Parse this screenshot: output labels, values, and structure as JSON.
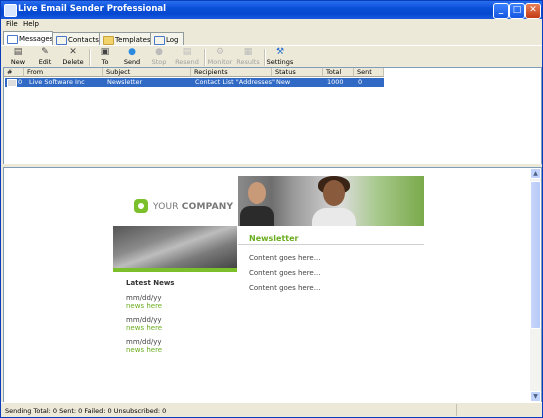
{
  "window": {
    "title": "Live Email Sender Professional"
  },
  "menu": [
    "File",
    "Help"
  ],
  "tabs": [
    "Messages",
    "Contacts",
    "Templates",
    "Log"
  ],
  "toolbar": [
    {
      "label": "New",
      "icon": "new-icon",
      "enabled": true
    },
    {
      "label": "Edit",
      "icon": "edit-icon",
      "enabled": true
    },
    {
      "label": "Delete",
      "icon": "delete-icon",
      "enabled": true
    },
    {
      "label": "To",
      "icon": "to-icon",
      "enabled": true
    },
    {
      "label": "Send",
      "icon": "send-icon",
      "enabled": true
    },
    {
      "label": "Stop",
      "icon": "stop-icon",
      "enabled": false
    },
    {
      "label": "Resend",
      "icon": "resend-icon",
      "enabled": false
    },
    {
      "label": "Monitor",
      "icon": "monitor-icon",
      "enabled": false
    },
    {
      "label": "Results",
      "icon": "results-icon",
      "enabled": false
    },
    {
      "label": "Settings",
      "icon": "settings-icon",
      "enabled": true
    }
  ],
  "table": {
    "columns": [
      "#",
      "From",
      "Subject",
      "Recipients",
      "Status",
      "Total",
      "Sent"
    ],
    "rows": [
      {
        "num": "0",
        "from": "Live Software Inc",
        "subject": "Newsletter",
        "recipients": "Contact List \"Addresses\"",
        "status": "New",
        "total": "1000",
        "sent": "0"
      }
    ]
  },
  "preview": {
    "logo_your": "YOUR ",
    "logo_company": "COMPANY",
    "newsletter_title": "Newsletter",
    "content_lines": [
      "Content goes here...",
      "Content goes here...",
      "Content goes here..."
    ],
    "latest_news_title": "Latest News",
    "news_items": [
      {
        "date": "mm/dd/yy",
        "link": "news here"
      },
      {
        "date": "mm/dd/yy",
        "link": "news here"
      },
      {
        "date": "mm/dd/yy",
        "link": "news here"
      }
    ]
  },
  "status": {
    "text": "Sending Total: 0 Sent: 0 Failed: 0 Unsubscribed: 0"
  },
  "colors": {
    "title_bar": "#0a4fd8",
    "selection": "#316ac5",
    "accent_green": "#7bbf2a"
  }
}
